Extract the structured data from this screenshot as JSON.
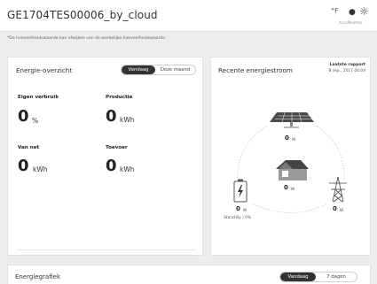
{
  "header": {
    "title": "GE1704TES00006_by_cloud",
    "weather": {
      "unit": "°F",
      "drop_icon": "drop-icon",
      "sun_icon": "sun-icon",
      "credit": "AccuWeather"
    }
  },
  "note": "*De hoeveelheidswaarde kan afwijken van de werkelijke hoeveelheidswaarde.",
  "overview": {
    "title": "Energie-overzicht",
    "toggle": {
      "active": "Vandaag",
      "inactive": "Deze maand"
    },
    "metrics": {
      "eigen": {
        "label": "Eigen verbruik",
        "value": "0",
        "unit": "%"
      },
      "productie": {
        "label": "Productie",
        "value": "0",
        "unit": "kWh"
      },
      "vannet": {
        "label": "Van net",
        "value": "0",
        "unit": "kWh"
      },
      "toevoer": {
        "label": "Toevoer",
        "value": "0",
        "unit": "kWh"
      }
    }
  },
  "flow": {
    "title": "Recente energiestroom",
    "report_label": "Laatste rapport",
    "report_date": "8 sep., 2017 04:04",
    "solar": {
      "value": "0",
      "unit": "W"
    },
    "house": {
      "value": "0",
      "unit": "W"
    },
    "battery": {
      "value": "0",
      "unit": "W",
      "status": "Stand-By | 0%"
    },
    "grid": {
      "value": "0",
      "unit": "W"
    },
    "colors": {
      "solar_panel": "#4a4a4a",
      "house_roof": "#444444",
      "house_body": "#9a9a9a"
    }
  },
  "graph": {
    "title": "Energiegrafiek",
    "toggle": {
      "active": "Vandaag",
      "inactive": "7 dagen"
    }
  }
}
